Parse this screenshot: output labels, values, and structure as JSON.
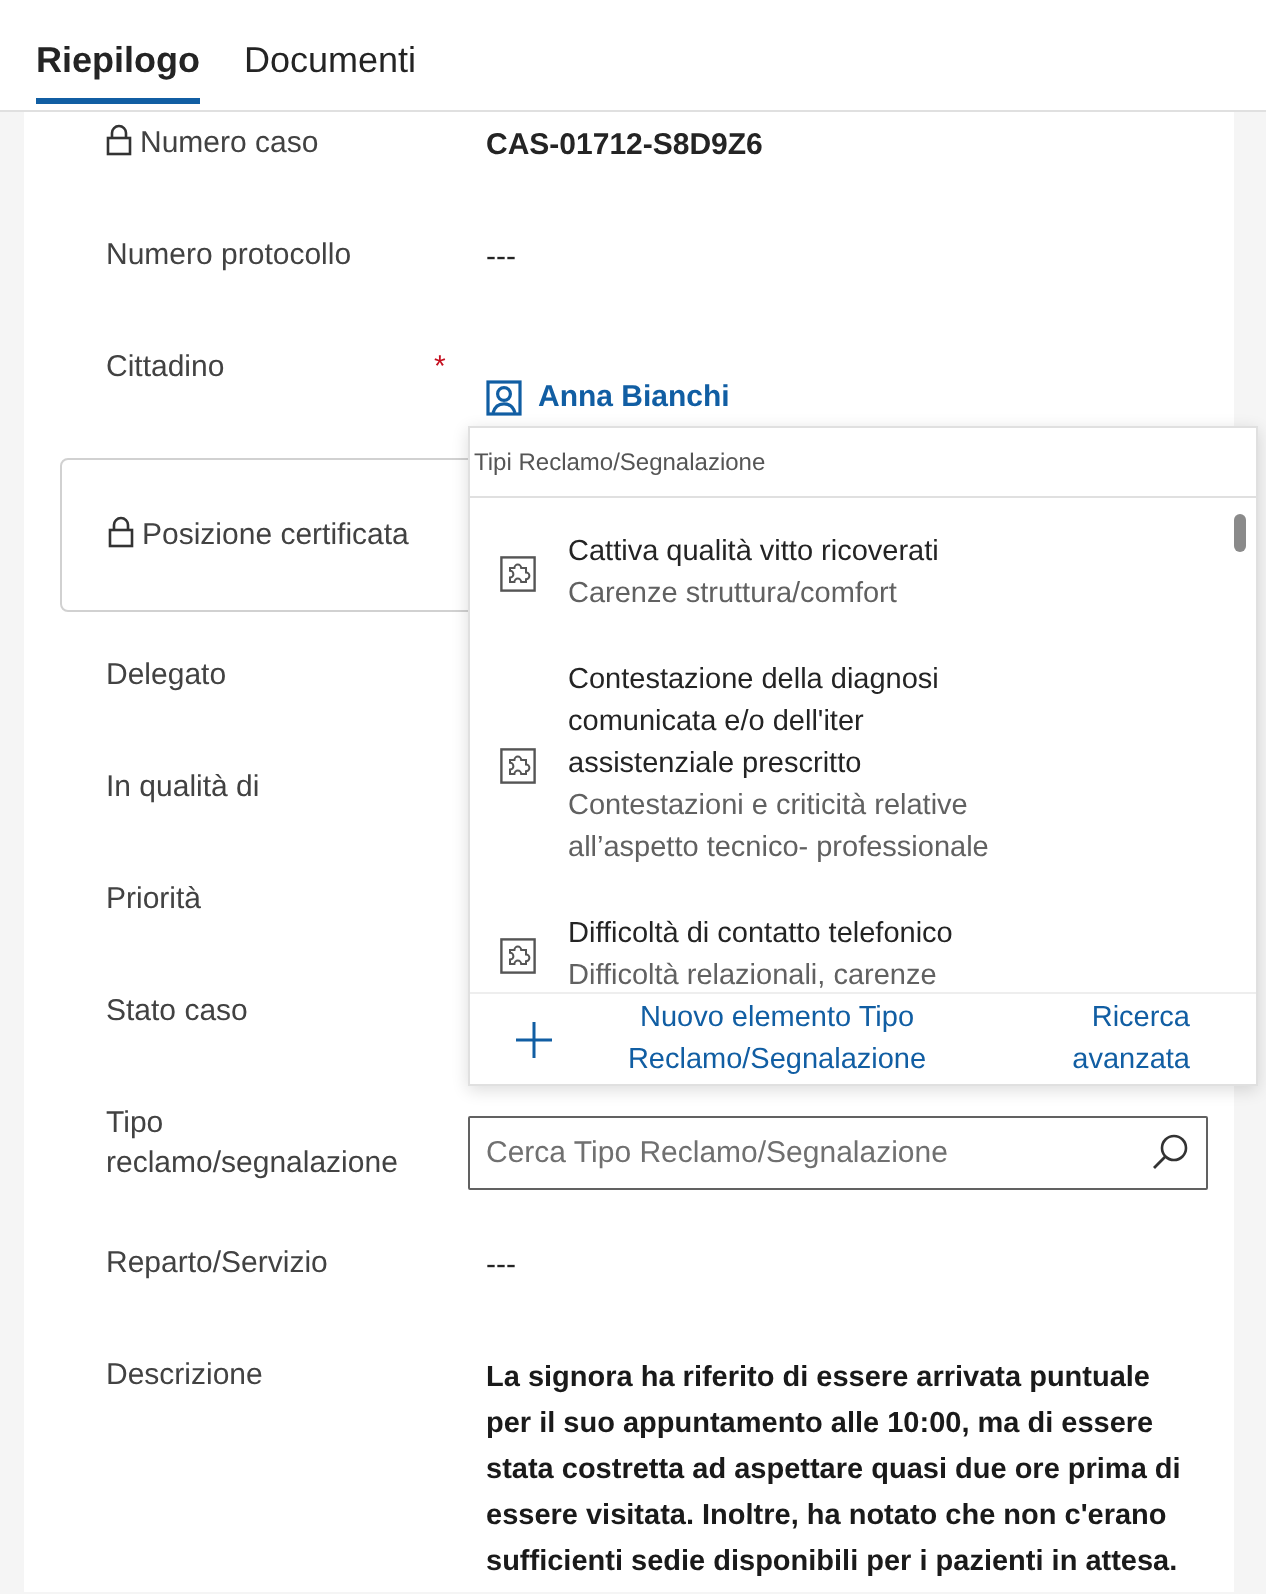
{
  "tabs": [
    {
      "label": "Riepilogo",
      "selected": true
    },
    {
      "label": "Documenti",
      "selected": false
    }
  ],
  "fields": [
    {
      "kind": "text",
      "label": "Numero caso",
      "value": "CAS-01712-S8D9Z6",
      "locked": true
    },
    {
      "kind": "text",
      "label": "Numero protocollo",
      "value": "---",
      "locked": false
    },
    {
      "kind": "person",
      "label": "Cittadino",
      "value": "Anna Bianchi",
      "locked": false,
      "required_mark": "*"
    },
    {
      "kind": "section",
      "label": "Posizione certificata",
      "locked": true
    },
    {
      "kind": "text",
      "label": "Delegato",
      "locked": false
    },
    {
      "kind": "text",
      "label": "In qualità di",
      "locked": false
    },
    {
      "kind": "text",
      "label": "Priorità",
      "locked": false
    },
    {
      "kind": "text",
      "label": "Stato caso",
      "locked": false
    },
    {
      "kind": "search",
      "label": "Tipo reclamo/segnalazione",
      "locked": false,
      "placeholder": "Cerca Tipo Reclamo/Segnalazione",
      "flyout": {
        "header": "Tipi Reclamo/Segnalazione",
        "items": [
          {
            "title": "Cattiva qualità vitto ricoverati",
            "subtitle": "Carenze struttura/comfort"
          },
          {
            "title": "Contestazione della diagnosi comunicata e/o dell'iter assistenziale prescritto",
            "subtitle": "Contestazioni e criticità relative all’aspetto tecnico- professionale"
          },
          {
            "title": "Difficoltà di contatto telefonico",
            "subtitle": "Difficoltà relazionali, carenze"
          }
        ],
        "new_link": "Nuovo elemento Tipo Reclamo/Segnalazione",
        "advanced_link": "Ricerca avanzata"
      }
    },
    {
      "kind": "text",
      "label": "Reparto/Servizio",
      "value": "---",
      "locked": false
    },
    {
      "kind": "description",
      "label": "Descrizione",
      "value": "La signora ha riferito di essere arrivata puntuale per il suo appuntamento alle 10:00, ma di essere stata costretta ad aspettare quasi due ore prima di essere visitata. Inoltre, ha notato che non c'erano sufficienti sedie disponibili per i pazienti in attesa.",
      "locked": false
    }
  ]
}
